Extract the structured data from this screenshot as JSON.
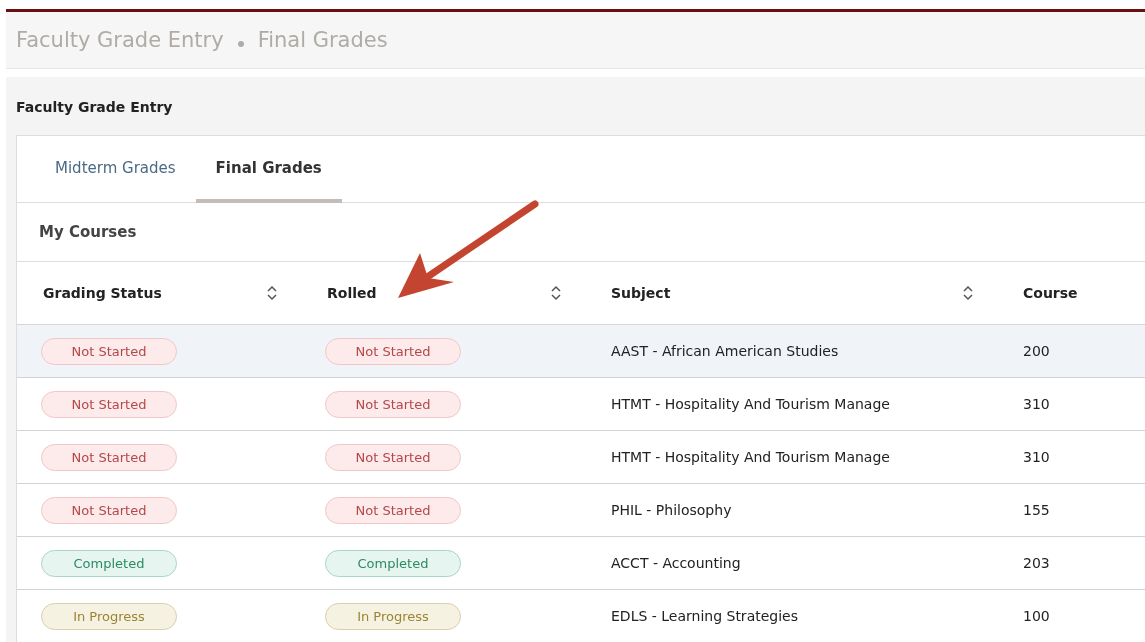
{
  "breadcrumb": [
    "Faculty Grade Entry",
    "Final Grades"
  ],
  "section_title": "Faculty Grade Entry",
  "tabs": [
    {
      "label": "Midterm Grades",
      "selected": false
    },
    {
      "label": "Final Grades",
      "selected": true
    }
  ],
  "panel_title": "My Courses",
  "table": {
    "columns": [
      {
        "label": "Grading Status",
        "sortable": true
      },
      {
        "label": "Rolled",
        "sortable": true
      },
      {
        "label": "Subject",
        "sortable": true
      },
      {
        "label": "Course",
        "sortable": false
      }
    ],
    "rows": [
      {
        "selected": true,
        "grading_status": {
          "kind": "not_started",
          "label": "Not Started"
        },
        "rolled": {
          "kind": "not_started",
          "label": "Not Started"
        },
        "subject": "AAST - African American Studies",
        "course": "200"
      },
      {
        "selected": false,
        "grading_status": {
          "kind": "not_started",
          "label": "Not Started"
        },
        "rolled": {
          "kind": "not_started",
          "label": "Not Started"
        },
        "subject": "HTMT - Hospitality And Tourism Manage",
        "course": "310"
      },
      {
        "selected": false,
        "grading_status": {
          "kind": "not_started",
          "label": "Not Started"
        },
        "rolled": {
          "kind": "not_started",
          "label": "Not Started"
        },
        "subject": "HTMT - Hospitality And Tourism Manage",
        "course": "310"
      },
      {
        "selected": false,
        "grading_status": {
          "kind": "not_started",
          "label": "Not Started"
        },
        "rolled": {
          "kind": "not_started",
          "label": "Not Started"
        },
        "subject": "PHIL - Philosophy",
        "course": "155"
      },
      {
        "selected": false,
        "grading_status": {
          "kind": "completed",
          "label": "Completed"
        },
        "rolled": {
          "kind": "completed",
          "label": "Completed"
        },
        "subject": "ACCT - Accounting",
        "course": "203"
      },
      {
        "selected": false,
        "grading_status": {
          "kind": "in_progress",
          "label": "In Progress"
        },
        "rolled": {
          "kind": "in_progress",
          "label": "In Progress"
        },
        "subject": "EDLS - Learning Strategies",
        "course": "100"
      }
    ]
  }
}
